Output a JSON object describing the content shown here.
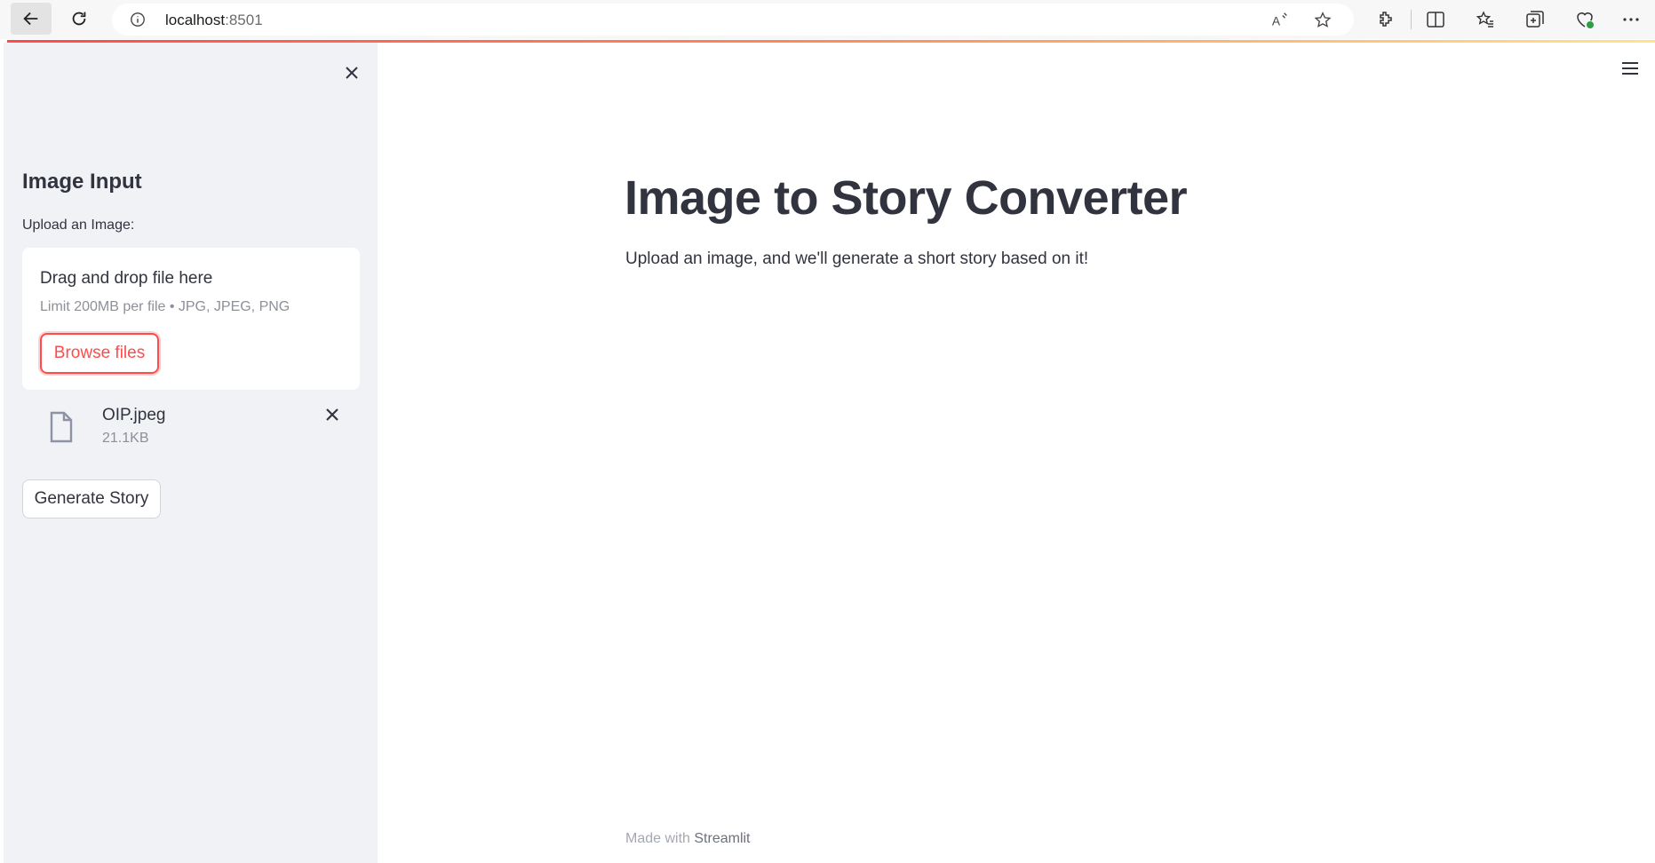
{
  "browser": {
    "url_host": "localhost",
    "url_port": ":8501"
  },
  "sidebar": {
    "heading": "Image Input",
    "upload_label": "Upload an Image:",
    "dropzone": {
      "title": "Drag and drop file here",
      "limit": "Limit 200MB per file • JPG, JPEG, PNG",
      "browse_label": "Browse files"
    },
    "file": {
      "name": "OIP.jpeg",
      "size": "21.1KB"
    },
    "generate_label": "Generate Story"
  },
  "main": {
    "title": "Image to Story Converter",
    "subtitle": "Upload an image, and we'll generate a short story based on it!"
  },
  "footer": {
    "prefix": "Made with ",
    "brand": "Streamlit"
  },
  "colors": {
    "accent": "#ff4b4b",
    "sidebar_bg": "#f0f2f6",
    "text": "#31333f"
  }
}
